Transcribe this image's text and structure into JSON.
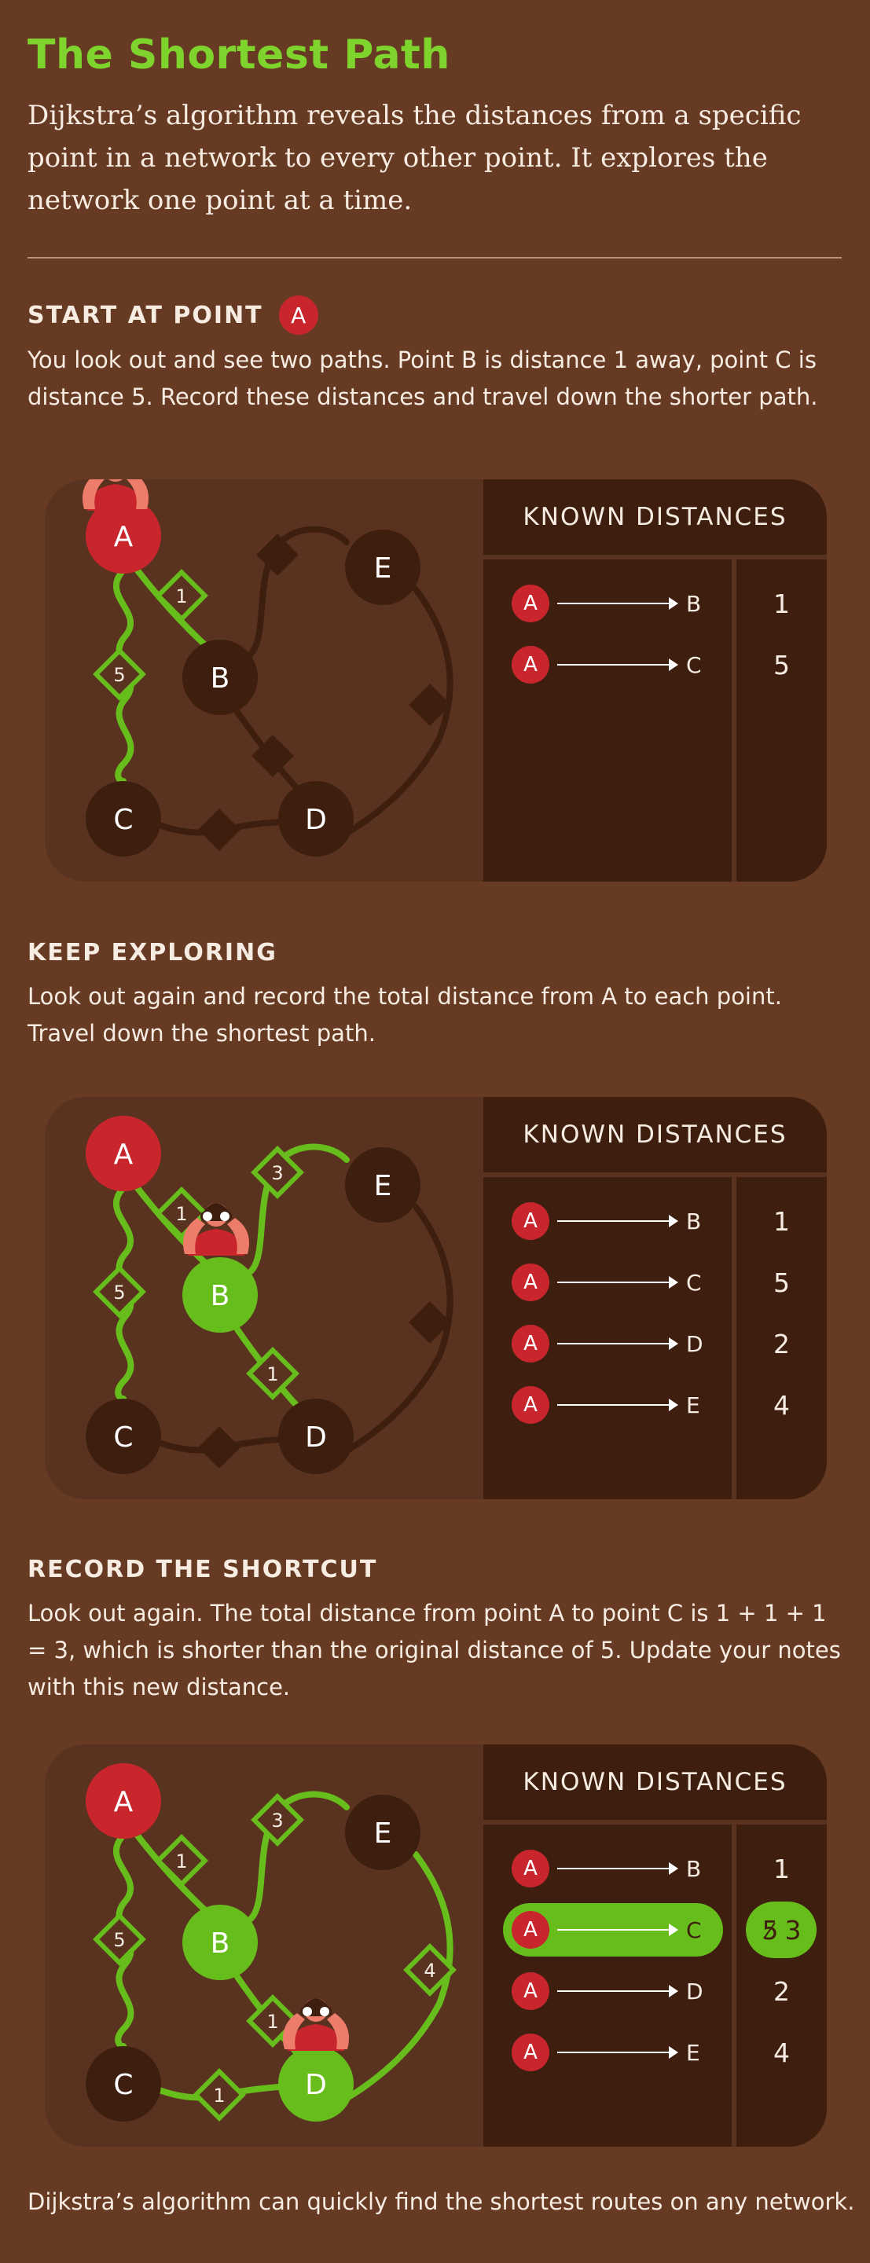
{
  "title": "The Shortest Path",
  "intro": "Dijkstra’s algorithm reveals the distances from a specific point in a network to every other point. It explores the network one point at a time.",
  "colors": {
    "background": "#673a23",
    "panel": "#5a3220",
    "dark_node": "#3e1f0f",
    "start_node": "#c9252d",
    "visited": "#67bd1c",
    "title": "#7ed32c"
  },
  "sections": [
    {
      "heading": "START AT POINT",
      "heading_badge": "A",
      "text": "You look out and see two paths. Point B is distance 1 away, point C is distance 5. Record these distances and travel down the shorter path.",
      "diagram": {
        "green_nodes": [],
        "edges": [
          {
            "from": "A",
            "to": "B",
            "weight": "1",
            "active": true
          },
          {
            "from": "A",
            "to": "C",
            "weight": "5",
            "active": true
          },
          {
            "from": "B",
            "to": "E",
            "weight": "",
            "active": false
          },
          {
            "from": "B",
            "to": "D",
            "weight": "",
            "active": false
          },
          {
            "from": "C",
            "to": "D",
            "weight": "",
            "active": false
          },
          {
            "from": "E",
            "to": "D",
            "weight": "",
            "active": false
          }
        ],
        "explorer_at": "A"
      },
      "table": {
        "title": "KNOWN DISTANCES",
        "rows": [
          {
            "from": "A",
            "to": "B",
            "value": "1"
          },
          {
            "from": "A",
            "to": "C",
            "value": "5"
          }
        ]
      }
    },
    {
      "heading": "KEEP EXPLORING",
      "heading_badge": "",
      "text": "Look out again and record the total distance from A to each point. Travel down the shortest path.",
      "diagram": {
        "green_nodes": [
          "B"
        ],
        "edges": [
          {
            "from": "A",
            "to": "B",
            "weight": "1",
            "active": true
          },
          {
            "from": "A",
            "to": "C",
            "weight": "5",
            "active": true
          },
          {
            "from": "B",
            "to": "E",
            "weight": "3",
            "active": true
          },
          {
            "from": "B",
            "to": "D",
            "weight": "1",
            "active": true
          },
          {
            "from": "C",
            "to": "D",
            "weight": "",
            "active": false
          },
          {
            "from": "E",
            "to": "D",
            "weight": "",
            "active": false
          }
        ],
        "explorer_at": "B"
      },
      "table": {
        "title": "KNOWN DISTANCES",
        "rows": [
          {
            "from": "A",
            "to": "B",
            "value": "1"
          },
          {
            "from": "A",
            "to": "C",
            "value": "5"
          },
          {
            "from": "A",
            "to": "D",
            "value": "2"
          },
          {
            "from": "A",
            "to": "E",
            "value": "4"
          }
        ]
      }
    },
    {
      "heading": "RECORD THE SHORTCUT",
      "heading_badge": "",
      "text": "Look out again. The total distance from point A to point C is 1 + 1 + 1 = 3, which is shorter than the original distance of 5. Update your notes with this new distance.",
      "diagram": {
        "green_nodes": [
          "B",
          "D"
        ],
        "edges": [
          {
            "from": "A",
            "to": "B",
            "weight": "1",
            "active": true
          },
          {
            "from": "A",
            "to": "C",
            "weight": "5",
            "active": true
          },
          {
            "from": "B",
            "to": "E",
            "weight": "3",
            "active": true
          },
          {
            "from": "B",
            "to": "D",
            "weight": "1",
            "active": true
          },
          {
            "from": "C",
            "to": "D",
            "weight": "1",
            "active": true
          },
          {
            "from": "E",
            "to": "D",
            "weight": "4",
            "active": true
          }
        ],
        "explorer_at": "D"
      },
      "table": {
        "title": "KNOWN DISTANCES",
        "rows": [
          {
            "from": "A",
            "to": "B",
            "value": "1"
          },
          {
            "from": "A",
            "to": "C",
            "value": "3",
            "old_value": "5",
            "highlight": true
          },
          {
            "from": "A",
            "to": "D",
            "value": "2"
          },
          {
            "from": "A",
            "to": "E",
            "value": "4"
          }
        ]
      }
    }
  ],
  "footer": "Dijkstra’s algorithm can quickly find the shortest routes on any network."
}
